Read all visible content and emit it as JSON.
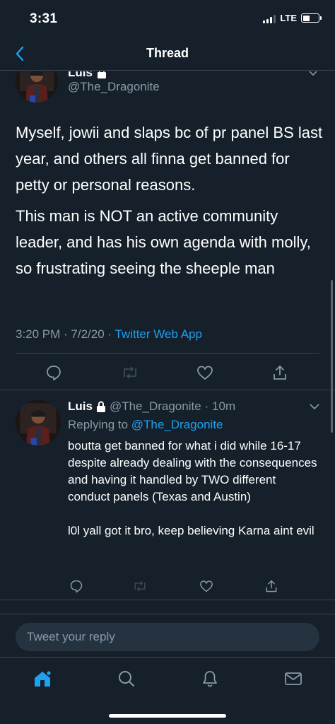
{
  "status_bar": {
    "time": "3:31",
    "network": "LTE"
  },
  "nav": {
    "title": "Thread"
  },
  "main_tweet": {
    "author": "Luis",
    "handle": "@The_Dragonite",
    "paragraphs": [
      "Myself, jowii and slaps bc of pr panel BS last year, and others all finna get banned for petty or personal reasons.",
      "This man is NOT an active community leader, and has his own agenda with molly, so frustrating seeing the sheeple man"
    ],
    "timestamp": "3:20 PM · 7/2/20 · ",
    "source": "Twitter Web App"
  },
  "reply": {
    "author": "Luis",
    "handle": "@The_Dragonite",
    "time": "· 10m",
    "replying_prefix": "Replying to ",
    "replying_to": "@The_Dragonite",
    "paragraph1": "boutta get banned for what i did while 16-17 despite already dealing with the consequences and having it handled by TWO different conduct panels (Texas and Austin)",
    "paragraph2": "l0l yall got it bro, keep believing Karna aint evil"
  },
  "compose": {
    "placeholder": "Tweet your reply"
  },
  "tabs": [
    "home-icon",
    "search-icon",
    "notifications-icon",
    "messages-icon"
  ],
  "colors": {
    "background": "#15202b",
    "accent": "#1da1f2",
    "secondary_text": "#8899a6",
    "divider": "#38444d"
  }
}
